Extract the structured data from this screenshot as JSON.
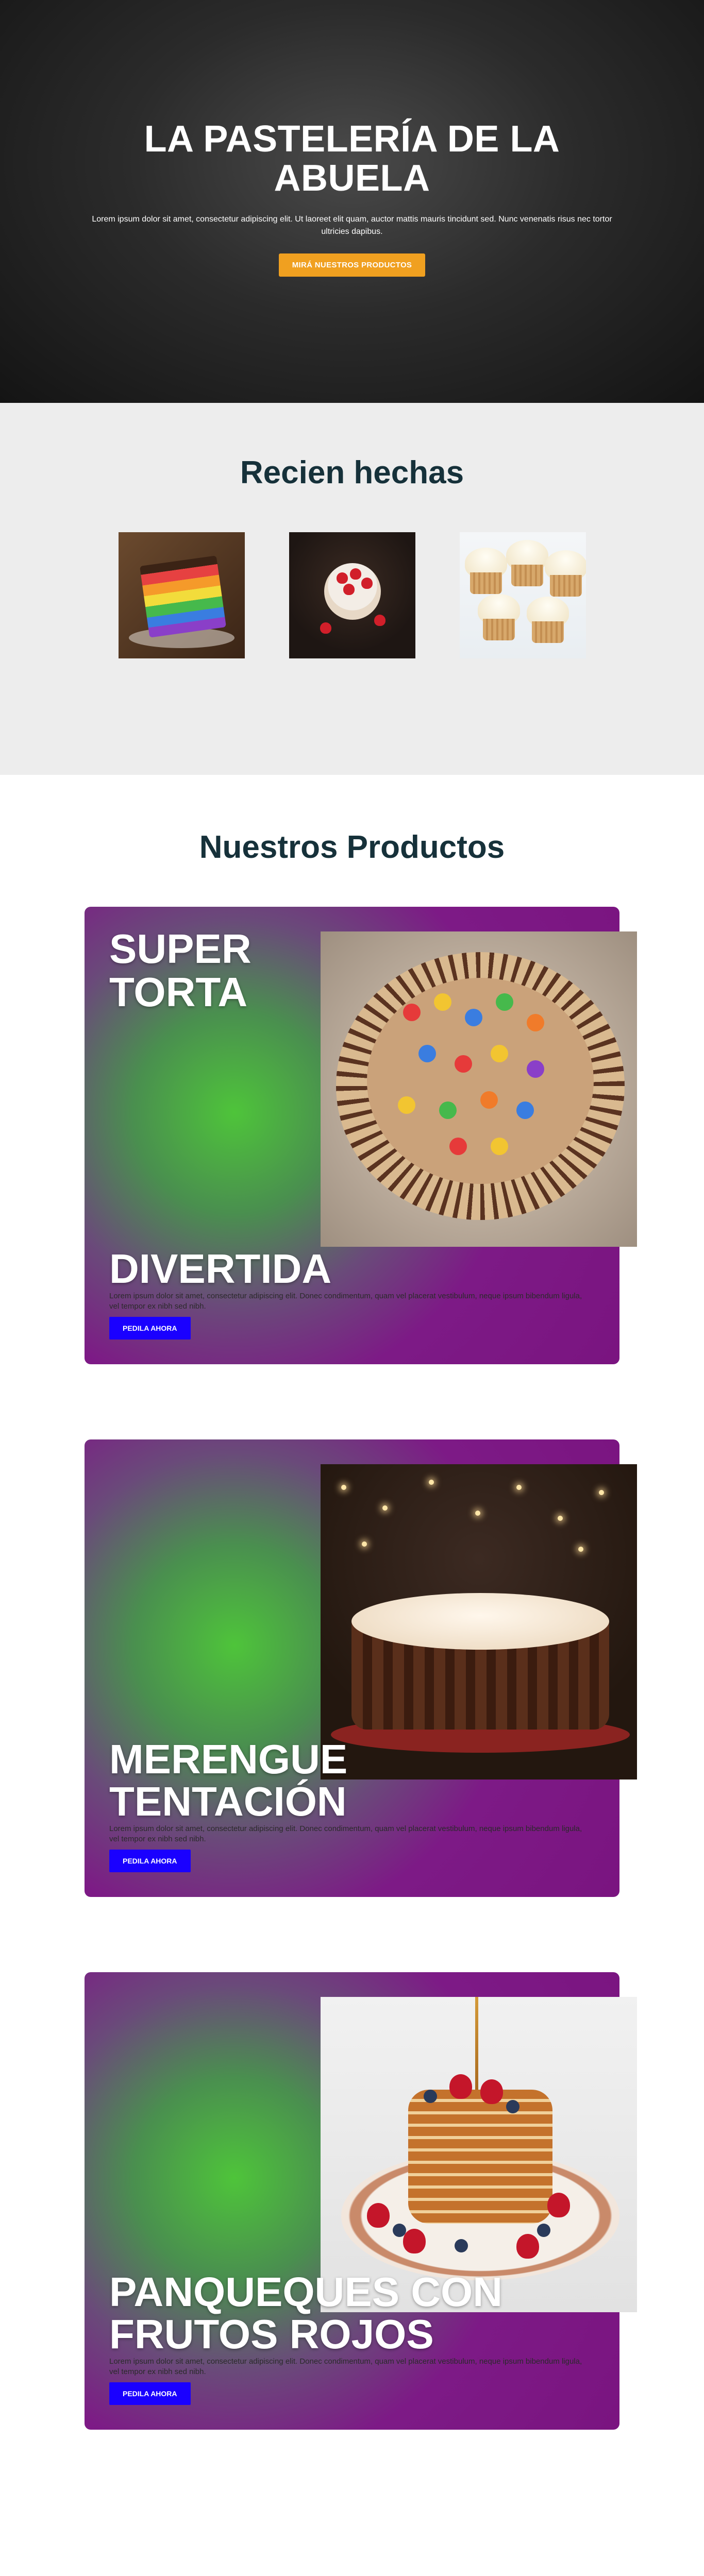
{
  "hero": {
    "title": "LA PASTELERÍA DE LA ABUELA",
    "text": "Lorem ipsum dolor sit amet, consectetur adipiscing elit. Ut laoreet elit quam, auctor mattis mauris tincidunt sed. Nunc venenatis risus nec tortor ultricies dapibus.",
    "button": "MIRÁ NUESTROS PRODUCTOS"
  },
  "recent": {
    "title": "Recien hechas",
    "images": [
      {
        "icon": "rainbow-cake-slice-image"
      },
      {
        "icon": "strawberry-cheesecake-image"
      },
      {
        "icon": "cupcakes-image"
      }
    ]
  },
  "products": {
    "title": "Nuestros Productos",
    "items": [
      {
        "top_title": "SUPER TORTA",
        "title": "DIVERTIDA",
        "text": "Lorem ipsum dolor sit amet, consectetur adipiscing elit. Donec condimentum, quam vel placerat vestibulum, neque ipsum bibendum ligula, vel tempor ex nibh sed nibh.",
        "button": "PEDILA AHORA",
        "image": "candy-chocolate-cake-image"
      },
      {
        "top_title": "",
        "title": "MERENGUE TENTACIÓN",
        "text": "Lorem ipsum dolor sit amet, consectetur adipiscing elit. Donec condimentum, quam vel placerat vestibulum, neque ipsum bibendum ligula, vel tempor ex nibh sed nibh.",
        "button": "PEDILA AHORA",
        "image": "meringue-chocolate-cake-image"
      },
      {
        "top_title": "",
        "title": "PANQUEQUES CON FRUTOS ROJOS",
        "text": "Lorem ipsum dolor sit amet, consectetur adipiscing elit. Donec condimentum, quam vel placerat vestibulum, neque ipsum bibendum ligula, vel tempor ex nibh sed nibh.",
        "button": "PEDILA AHORA",
        "image": "berry-pancakes-image"
      }
    ]
  },
  "colors": {
    "hero_button": "#f0a020",
    "product_button": "#1a00ff",
    "card_purple": "#7a1480",
    "card_green": "#4ec43a",
    "heading": "#16313a"
  }
}
